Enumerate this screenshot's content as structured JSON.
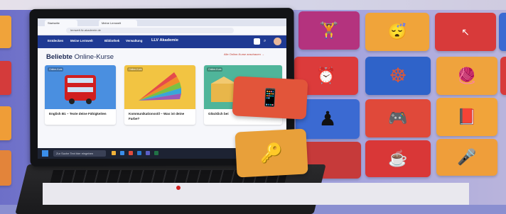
{
  "browser": {
    "tabs": [
      "Startseite",
      "Meine Lernwelt"
    ],
    "url": "lernwelt.llv-akademie.de"
  },
  "site": {
    "nav": [
      "Entdecken",
      "Meine Lernwelt",
      "Bibliothek",
      "Verwaltung"
    ],
    "brand": "LLV Akademie",
    "heading_bold": "Beliebte",
    "heading_light": "Online-Kurse",
    "all_courses_link": "Alle Online-Kurse anschauen →"
  },
  "courses": [
    {
      "badge": "Online-Kurs",
      "title": "English B1 – Texte deine Fähigkeiten",
      "color": "#4a8fe0"
    },
    {
      "badge": "Online-Kurs",
      "title": "Kommunikationsstil – Was ist deine Farbe?",
      "color": "#f2c442"
    },
    {
      "badge": "Online-Kurs",
      "title": "Glücklich bei",
      "color": "#4fb59a"
    }
  ],
  "taskbar": {
    "search_placeholder": "Zur Suche Text hier eingeben"
  },
  "tiles": [
    {
      "icon": "dumbbell-icon",
      "glyph": "🏋",
      "color": "#b4337e"
    },
    {
      "icon": "sleep-mask-icon",
      "glyph": "😴",
      "color": "#f0a43a"
    },
    {
      "icon": "cursor-icon",
      "glyph": "↖",
      "color": "#d83a3a"
    },
    {
      "icon": "alarm-clock-icon",
      "glyph": "⏰",
      "color": "#dc3b3b"
    },
    {
      "icon": "ship-wheel-icon",
      "glyph": "☸",
      "color": "#2f63c9"
    },
    {
      "icon": "yarn-ball-icon",
      "glyph": "🧶",
      "color": "#efa33d"
    },
    {
      "icon": "chess-piece-icon",
      "glyph": "♟",
      "color": "#3b6ad2"
    },
    {
      "icon": "game-controller-icon",
      "glyph": "🎮",
      "color": "#e0493a"
    },
    {
      "icon": "notebook-icon",
      "glyph": "📕",
      "color": "#f1a43a"
    },
    {
      "icon": "coffee-cup-icon",
      "glyph": "☕",
      "color": "#d93737"
    },
    {
      "icon": "microphone-icon",
      "glyph": "🎤",
      "color": "#ef9e3a"
    }
  ],
  "floating": [
    {
      "icon": "tablet-icon",
      "glyph": "📱",
      "color": "#e2553a"
    },
    {
      "icon": "keys-icon",
      "glyph": "🔑",
      "color": "#e8a03a"
    }
  ]
}
